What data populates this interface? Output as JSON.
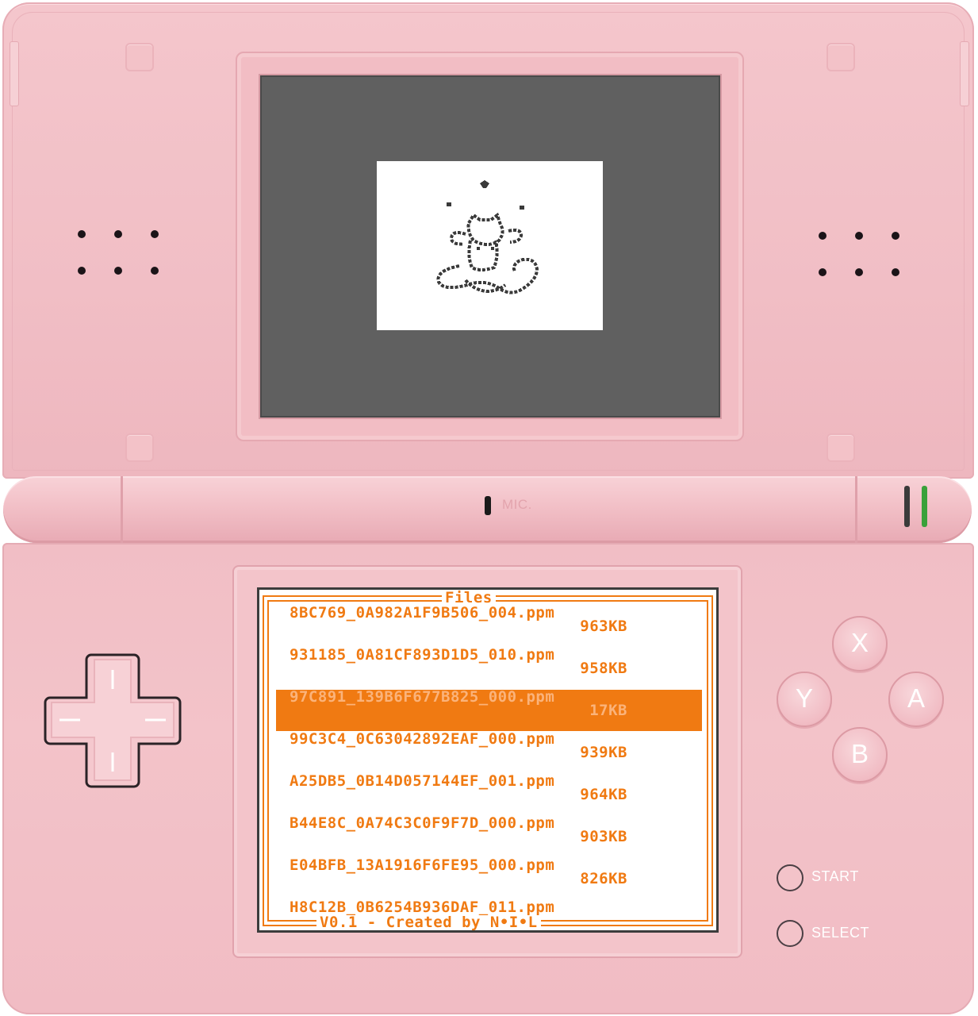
{
  "device": {
    "mic_label": "MIC."
  },
  "top_screen": {
    "preview_description_icon": "flipnote-thumbnail-cat-juggling"
  },
  "file_browser": {
    "title": "Files",
    "footer": "V0.1 - Created by N•I•L",
    "selected_index": 2,
    "files": [
      {
        "name": "8BC769_0A982A1F9B506_004.ppm",
        "size": "963KB"
      },
      {
        "name": "931185_0A81CF893D1D5_010.ppm",
        "size": "958KB"
      },
      {
        "name": "97C891_139B6F677B825_000.ppm",
        "size": "17KB"
      },
      {
        "name": "99C3C4_0C63042892EAF_000.ppm",
        "size": "939KB"
      },
      {
        "name": "A25DB5_0B14D057144EF_001.ppm",
        "size": "964KB"
      },
      {
        "name": "B44E8C_0A74C3C0F9F7D_000.ppm",
        "size": "903KB"
      },
      {
        "name": "E04BFB_13A1916F6FE95_000.ppm",
        "size": "826KB"
      },
      {
        "name": "H8C12B_0B6254B936DAF_011.ppm",
        "size": ""
      }
    ]
  },
  "buttons": {
    "x": "X",
    "y": "Y",
    "a": "A",
    "b": "B",
    "start": "START",
    "select": "SELECT"
  },
  "colors": {
    "shell": "#f2c0c7",
    "accent": "#f07a12",
    "led_power": "#3aa13a",
    "screen_off": "#606060"
  }
}
